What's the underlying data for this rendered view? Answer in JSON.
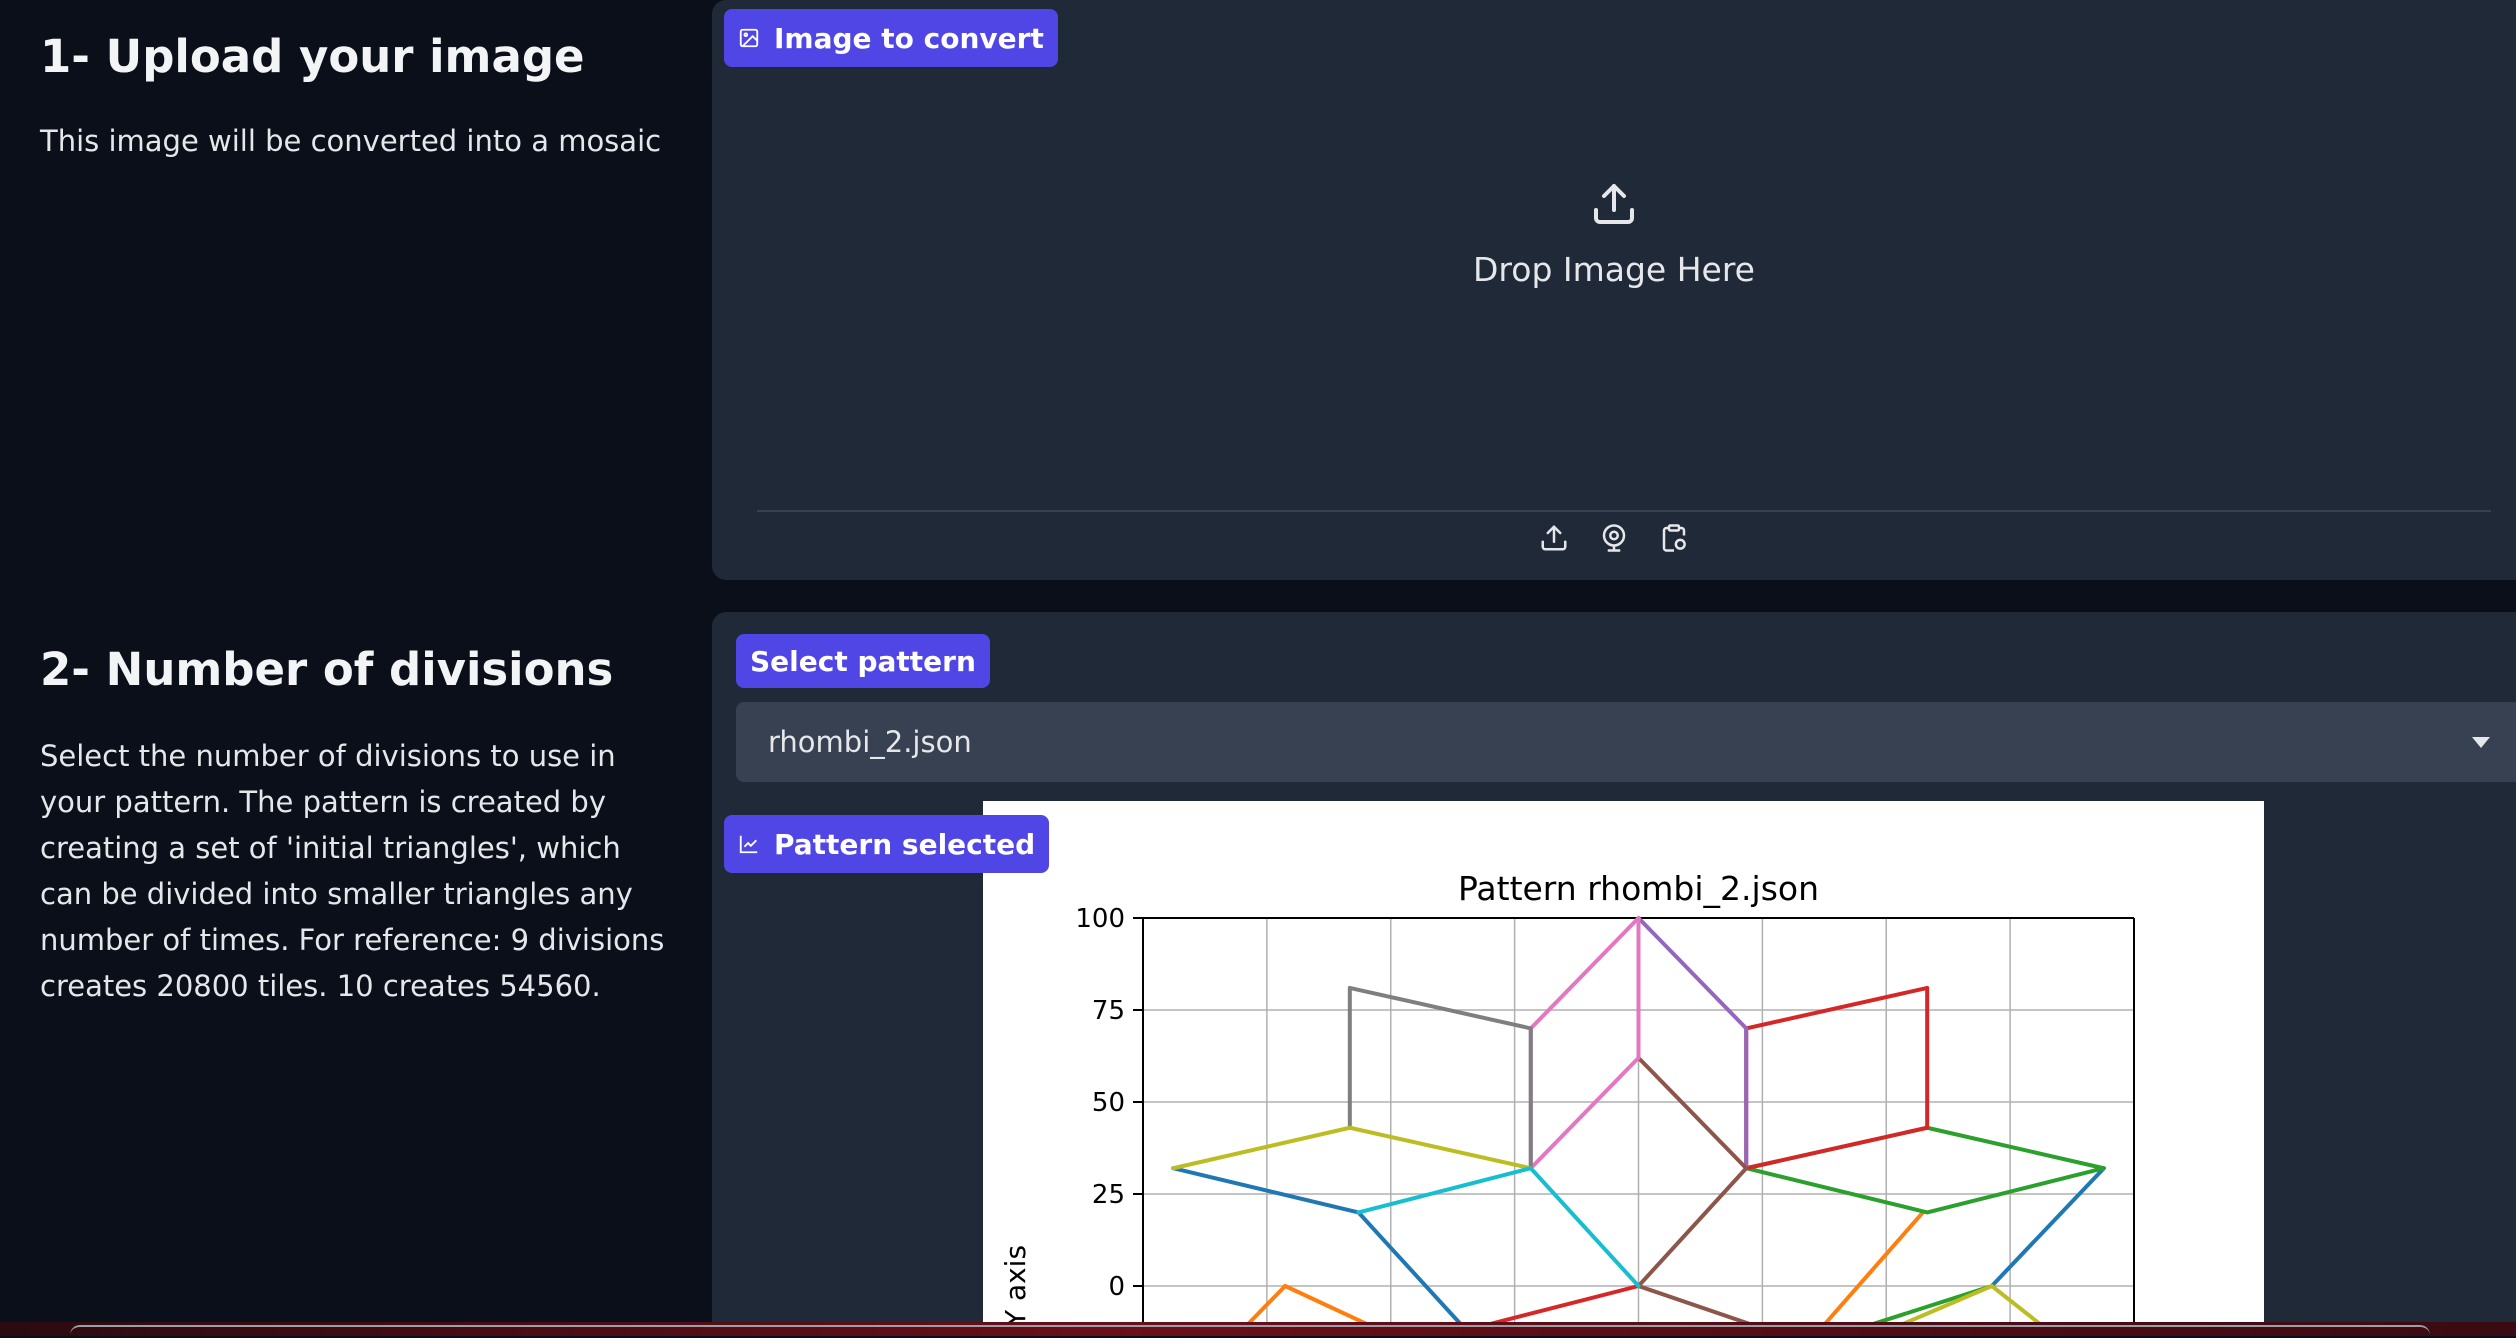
{
  "section1": {
    "heading": "1- Upload your image",
    "description": "This image will be converted into a mosaic",
    "badge": "Image to convert",
    "drop_label": "Drop Image Here",
    "tools": [
      "upload-icon",
      "webcam-icon",
      "clipboard-icon"
    ]
  },
  "section2": {
    "heading": "2- Number of divisions",
    "description": "Select the number of divisions to use in your pattern. The pattern is created by creating a set of 'initial triangles', which can be divided into smaller triangles any number of times. For reference: 9 divisions creates 20800 tiles. 10 creates 54560.",
    "select_badge": "Select pattern",
    "selected_value": "rhombi_2.json",
    "pattern_badge": "Pattern selected"
  },
  "colors": {
    "accent": "#4f46e5",
    "panel": "#1f2937",
    "background": "#0b0f19"
  },
  "chart_data": {
    "type": "line",
    "title": "Pattern rhombi_2.json",
    "xlabel": "",
    "ylabel": "Y axis",
    "ylim": [
      -12,
      100
    ],
    "xlim": [
      -115,
      115
    ],
    "yticks": [
      0,
      25,
      50,
      75,
      100
    ],
    "grid": true,
    "series": [
      {
        "color": "#1f77b4",
        "x": [
          -108,
          -65,
          -40
        ],
        "y": [
          32,
          20,
          -12
        ]
      },
      {
        "color": "#1f77b4",
        "x": [
          108,
          82
        ],
        "y": [
          32,
          0
        ]
      },
      {
        "color": "#ff7f0e",
        "x": [
          -82,
          -60
        ],
        "y": [
          0,
          -12
        ]
      },
      {
        "color": "#ff7f0e",
        "x": [
          -82,
          -92
        ],
        "y": [
          0,
          -12
        ]
      },
      {
        "color": "#ff7f0e",
        "x": [
          66,
          42
        ],
        "y": [
          20,
          -12
        ]
      },
      {
        "color": "#2ca02c",
        "x": [
          25,
          67,
          108,
          67,
          25
        ],
        "y": [
          32,
          43,
          32,
          20,
          32
        ]
      },
      {
        "color": "#2ca02c",
        "x": [
          82,
          50
        ],
        "y": [
          0,
          -12
        ]
      },
      {
        "color": "#d62728",
        "x": [
          25,
          67,
          67,
          25,
          25
        ],
        "y": [
          70,
          81,
          43,
          32,
          70
        ]
      },
      {
        "color": "#d62728",
        "x": [
          0,
          -40
        ],
        "y": [
          0,
          -12
        ]
      },
      {
        "color": "#9467bd",
        "x": [
          0,
          25,
          25
        ],
        "y": [
          100,
          70,
          32
        ]
      },
      {
        "color": "#8c564b",
        "x": [
          25,
          0,
          25
        ],
        "y": [
          32,
          62,
          32
        ]
      },
      {
        "color": "#8c564b",
        "x": [
          25,
          0,
          30
        ],
        "y": [
          32,
          0,
          -12
        ]
      },
      {
        "color": "#e377c2",
        "x": [
          -25,
          0,
          0,
          -25,
          -25
        ],
        "y": [
          70,
          100,
          62,
          32,
          70
        ]
      },
      {
        "color": "#7f7f7f",
        "x": [
          -67,
          -67,
          -25,
          -25
        ],
        "y": [
          43,
          81,
          70,
          32
        ]
      },
      {
        "color": "#bcbd22",
        "x": [
          -108,
          -67,
          -25
        ],
        "y": [
          32,
          43,
          32
        ]
      },
      {
        "color": "#bcbd22",
        "x": [
          82,
          58
        ],
        "y": [
          0,
          -12
        ]
      },
      {
        "color": "#bcbd22",
        "x": [
          82,
          95
        ],
        "y": [
          0,
          -12
        ]
      },
      {
        "color": "#17becf",
        "x": [
          -65,
          -25,
          0
        ],
        "y": [
          20,
          32,
          0
        ]
      }
    ]
  }
}
